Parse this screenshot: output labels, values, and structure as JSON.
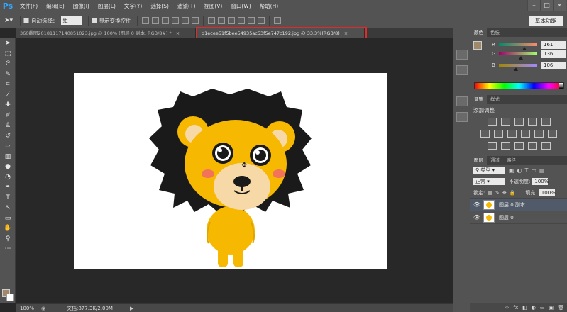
{
  "app": {
    "logo": "Ps"
  },
  "menu": [
    "文件(F)",
    "编辑(E)",
    "图像(I)",
    "图层(L)",
    "文字(Y)",
    "选择(S)",
    "滤镜(T)",
    "视图(V)",
    "窗口(W)",
    "帮助(H)"
  ],
  "window_controls": {
    "minimize": "–",
    "maximize": "□",
    "close": "×"
  },
  "options": {
    "auto_select_label": "自动选择：",
    "auto_select_value": "组",
    "show_transform_label": "显示变换控件",
    "workspace_label": "基本功能"
  },
  "tabs": [
    {
      "label": "360截图20181117140851023.jpg @ 100% (图层 0 副本, RGB/8#) *",
      "close": "×"
    },
    {
      "label": "d1ecee51f5bee54935ac53f5e747c192.jpg @ 33.3%(RGB/8)",
      "close": "×"
    }
  ],
  "status": {
    "zoom": "100%",
    "doc_info": "文档:877.3K/2.00M",
    "arrow": "▶"
  },
  "color_panel": {
    "tabs": [
      "颜色",
      "色板"
    ],
    "r_label": "R",
    "g_label": "G",
    "b_label": "B",
    "r": 161,
    "g": 136,
    "b": 106,
    "foreground": "#a1886a"
  },
  "adjust_panel": {
    "tabs": [
      "调整",
      "样式"
    ],
    "title": "添加调整"
  },
  "layers_panel": {
    "tabs": [
      "图层",
      "通道",
      "路径"
    ],
    "filter_label": "类型",
    "blend_mode": "正常",
    "opacity_label": "不透明度:",
    "opacity": "100%",
    "lock_label": "锁定:",
    "fill_label": "填充:",
    "fill": "100%",
    "layers": [
      {
        "name": "图层 0 副本",
        "selected": true
      },
      {
        "name": "图层 0",
        "selected": false
      }
    ],
    "footer_icons": [
      "∞",
      "fx",
      "◧",
      "◐",
      "▭",
      "▣",
      "🗑"
    ]
  },
  "colors": {
    "highlight": "#e12b2b",
    "lion_yellow": "#f6b800",
    "mane": "#1a1a1a"
  }
}
